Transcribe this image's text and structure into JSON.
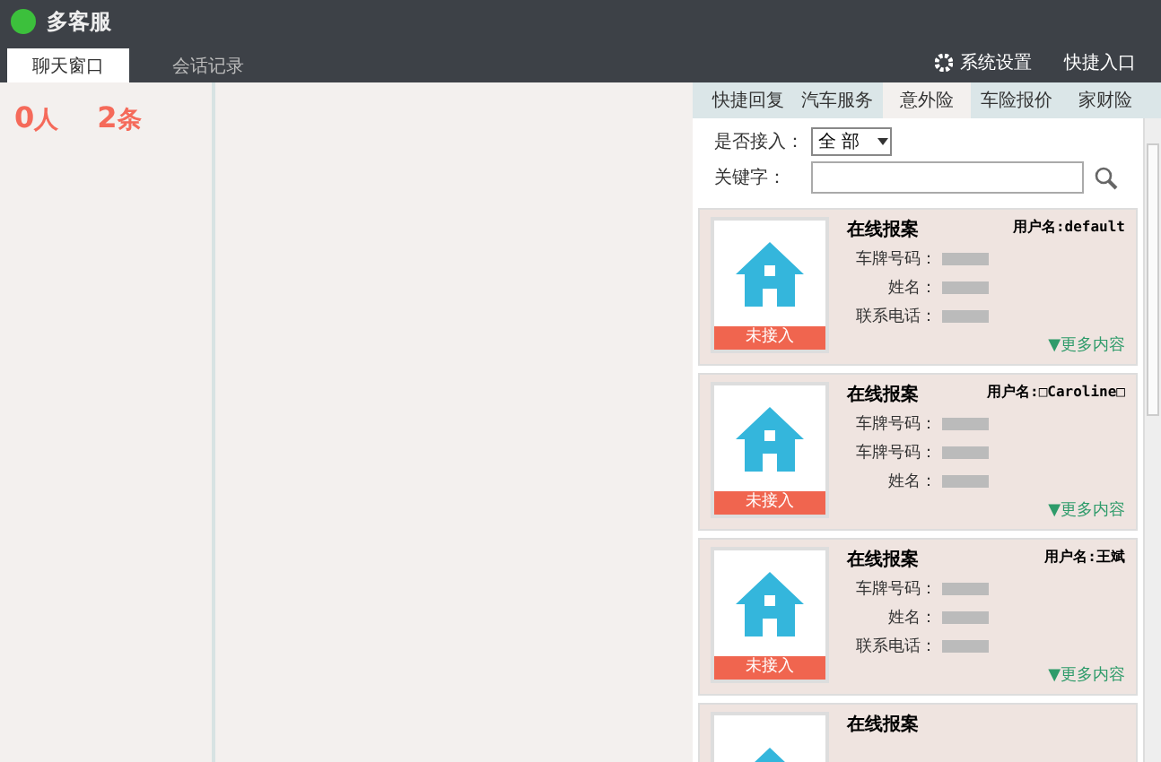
{
  "window": {
    "title": "多客服"
  },
  "header": {
    "settings": "系统设置",
    "quick_entry": "快捷入口"
  },
  "left_tabs": [
    {
      "label": "聊天窗口",
      "selected": true
    },
    {
      "label": "会话记录",
      "selected": false
    }
  ],
  "stats": [
    {
      "value": "0",
      "unit": "人"
    },
    {
      "value": "2",
      "unit": "条"
    }
  ],
  "right_tabs": [
    {
      "label": "快捷回复",
      "selected": false
    },
    {
      "label": "汽车服务",
      "selected": false
    },
    {
      "label": "意外险",
      "selected": true
    },
    {
      "label": "车险报价",
      "selected": false
    },
    {
      "label": "家财险",
      "selected": false
    }
  ],
  "filter": {
    "access_label": "是否接入：",
    "access_value": "全 部",
    "keyword_label": "关键字："
  },
  "cards": [
    {
      "title": "在线报案",
      "user": "用户名:default",
      "status": "未接入",
      "fields": [
        "车牌号码：",
        "姓名：",
        "联系电话："
      ],
      "more": "▼更多内容"
    },
    {
      "title": "在线报案",
      "user": "用户名:□Caroline□",
      "status": "未接入",
      "fields": [
        "车牌号码：",
        "车牌号码：",
        "姓名："
      ],
      "more": "▼更多内容"
    },
    {
      "title": "在线报案",
      "user": "用户名:王斌",
      "status": "未接入",
      "fields": [
        "车牌号码：",
        "姓名：",
        "联系电话："
      ],
      "more": "▼更多内容"
    },
    {
      "title": "在线报案"
    }
  ]
}
